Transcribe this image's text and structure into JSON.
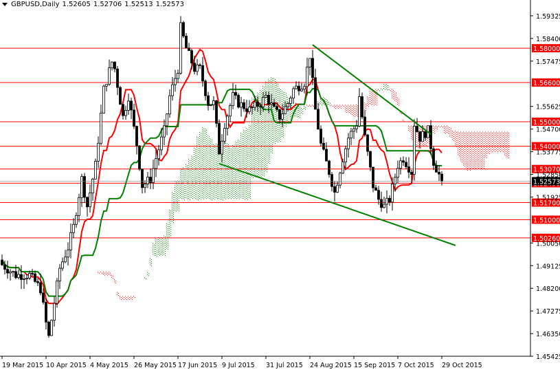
{
  "header": {
    "symbol_timeframe": "GBPUSD,Daily",
    "open": "1.52605",
    "high": "1.52706",
    "low": "1.52513",
    "close": "1.52573"
  },
  "colors": {
    "level": "#ff0000",
    "tenkan": "#ff0000",
    "kijun": "#008000",
    "trendline": "#008000",
    "bull_cloud": "#008000",
    "bear_cloud": "#ff0000",
    "candle": "#000000"
  },
  "chart_data": {
    "type": "candlestick",
    "title": "GBPUSD,Daily",
    "ylim": [
      1.45425,
      1.6
    ],
    "y_ticks": [
      "1.59325",
      "1.58400",
      "1.57475",
      "1.55625",
      "1.54700",
      "1.53775",
      "1.52850",
      "1.51925",
      "1.50050",
      "1.49125",
      "1.48200",
      "1.47275",
      "1.46350",
      "1.45425"
    ],
    "x_ticks": [
      {
        "bar": 0,
        "label": "19 Mar 2015"
      },
      {
        "bar": 16,
        "label": "10 Apr 2015"
      },
      {
        "bar": 32,
        "label": "4 May 2015"
      },
      {
        "bar": 48,
        "label": "26 May 2015"
      },
      {
        "bar": 64,
        "label": "17 Jun 2015"
      },
      {
        "bar": 80,
        "label": "9 Jul 2015"
      },
      {
        "bar": 96,
        "label": "31 Jul 2015"
      },
      {
        "bar": 112,
        "label": "24 Aug 2015"
      },
      {
        "bar": 128,
        "label": "15 Sep 2015"
      },
      {
        "bar": 144,
        "label": "7 Oct 2015"
      },
      {
        "bar": 160,
        "label": "29 Oct 2015"
      }
    ],
    "levels": [
      "1.58000",
      "1.56600",
      "1.55000",
      "1.54000",
      "1.53070",
      "1.52490",
      "1.51700",
      "1.51000",
      "1.50260"
    ],
    "current_price": "1.52573",
    "close_path": [
      [
        0,
        1.4916
      ],
      [
        5,
        1.4874
      ],
      [
        10,
        1.4874
      ],
      [
        14,
        1.4818
      ],
      [
        16,
        1.4678
      ],
      [
        17,
        1.4621
      ],
      [
        19,
        1.4762
      ],
      [
        21,
        1.4902
      ],
      [
        24,
        1.4986
      ],
      [
        26,
        1.5071
      ],
      [
        29,
        1.5267
      ],
      [
        31,
        1.5155
      ],
      [
        34,
        1.5323
      ],
      [
        37,
        1.5632
      ],
      [
        40,
        1.5744
      ],
      [
        41,
        1.5716
      ],
      [
        44,
        1.552
      ],
      [
        46,
        1.5604
      ],
      [
        49,
        1.5407
      ],
      [
        51,
        1.5239
      ],
      [
        54,
        1.5267
      ],
      [
        56,
        1.5351
      ],
      [
        59,
        1.5464
      ],
      [
        61,
        1.5604
      ],
      [
        64,
        1.5716
      ],
      [
        65,
        1.5885
      ],
      [
        67,
        1.58
      ],
      [
        70,
        1.5716
      ],
      [
        72,
        1.5716
      ],
      [
        75,
        1.5576
      ],
      [
        77,
        1.5576
      ],
      [
        79,
        1.5379
      ],
      [
        81,
        1.5492
      ],
      [
        84,
        1.5604
      ],
      [
        86,
        1.5576
      ],
      [
        90,
        1.5548
      ],
      [
        94,
        1.5576
      ],
      [
        96,
        1.5604
      ],
      [
        99,
        1.5548
      ],
      [
        101,
        1.552
      ],
      [
        104,
        1.5576
      ],
      [
        106,
        1.5632
      ],
      [
        110,
        1.566
      ],
      [
        112,
        1.5772
      ],
      [
        114,
        1.5548
      ],
      [
        116,
        1.5407
      ],
      [
        119,
        1.5295
      ],
      [
        121,
        1.5211
      ],
      [
        124,
        1.5351
      ],
      [
        126,
        1.5435
      ],
      [
        129,
        1.5492
      ],
      [
        130,
        1.5604
      ],
      [
        132,
        1.5435
      ],
      [
        135,
        1.5239
      ],
      [
        137,
        1.5183
      ],
      [
        139,
        1.5155
      ],
      [
        141,
        1.5183
      ],
      [
        144,
        1.5323
      ],
      [
        146,
        1.5351
      ],
      [
        149,
        1.5295
      ],
      [
        150,
        1.5492
      ],
      [
        152,
        1.5435
      ],
      [
        155,
        1.5464
      ],
      [
        157,
        1.5337
      ],
      [
        160,
        1.5257
      ]
    ],
    "trendlines": [
      {
        "from": [
          113,
          1.5814
        ],
        "to": [
          156,
          1.5449
        ]
      },
      {
        "from": [
          79,
          1.5329
        ],
        "to": [
          165,
          1.4995
        ]
      }
    ]
  }
}
